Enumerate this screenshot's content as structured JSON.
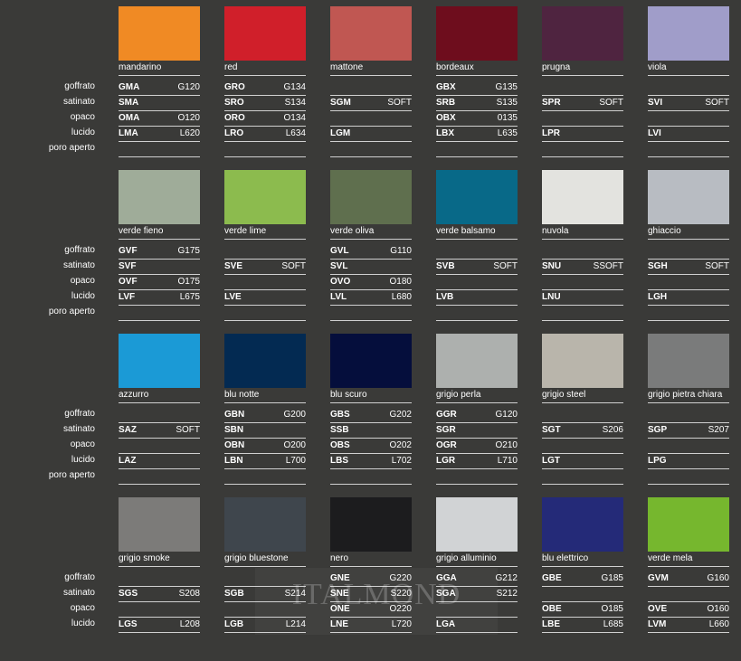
{
  "row_labels": [
    "goffrato",
    "satinato",
    "opaco",
    "lucido",
    "poro aperto"
  ],
  "blocks": [
    {
      "colors": [
        {
          "name": "mandarino",
          "swatch": "#f08a24",
          "rows": [
            [
              "GMA",
              "G120"
            ],
            [
              "SMA",
              ""
            ],
            [
              "OMA",
              "O120"
            ],
            [
              "LMA",
              "L620"
            ],
            [
              "",
              ""
            ]
          ]
        },
        {
          "name": "red",
          "swatch": "#d01f2a",
          "rows": [
            [
              "GRO",
              "G134"
            ],
            [
              "SRO",
              "S134"
            ],
            [
              "ORO",
              "O134"
            ],
            [
              "LRO",
              "L634"
            ],
            [
              "",
              ""
            ]
          ]
        },
        {
          "name": "mattone",
          "swatch": "#c05752",
          "rows": [
            [
              "",
              ""
            ],
            [
              "SGM",
              "SOFT"
            ],
            [
              "",
              ""
            ],
            [
              "LGM",
              ""
            ],
            [
              "",
              ""
            ]
          ]
        },
        {
          "name": "bordeaux",
          "swatch": "#6e0d1d",
          "rows": [
            [
              "GBX",
              "G135"
            ],
            [
              "SRB",
              "S135"
            ],
            [
              "OBX",
              "0135"
            ],
            [
              "LBX",
              "L635"
            ],
            [
              "",
              ""
            ]
          ]
        },
        {
          "name": "prugna",
          "swatch": "#4f2440",
          "rows": [
            [
              "",
              ""
            ],
            [
              "SPR",
              "SOFT"
            ],
            [
              "",
              ""
            ],
            [
              "LPR",
              ""
            ],
            [
              "",
              ""
            ]
          ]
        },
        {
          "name": "viola",
          "swatch": "#a09dc9",
          "rows": [
            [
              "",
              ""
            ],
            [
              "SVI",
              "SOFT"
            ],
            [
              "",
              ""
            ],
            [
              "LVI",
              ""
            ],
            [
              "",
              ""
            ]
          ]
        }
      ]
    },
    {
      "colors": [
        {
          "name": "verde fieno",
          "swatch": "#9fac99",
          "rows": [
            [
              "GVF",
              "G175"
            ],
            [
              "SVF",
              ""
            ],
            [
              "OVF",
              "O175"
            ],
            [
              "LVF",
              "L675"
            ],
            [
              "",
              ""
            ]
          ]
        },
        {
          "name": "verde lime",
          "swatch": "#8cbb4e",
          "rows": [
            [
              "",
              ""
            ],
            [
              "SVE",
              "SOFT"
            ],
            [
              "",
              ""
            ],
            [
              "LVE",
              ""
            ],
            [
              "",
              ""
            ]
          ]
        },
        {
          "name": "verde oliva",
          "swatch": "#5f6f4e",
          "rows": [
            [
              "GVL",
              "G110"
            ],
            [
              "SVL",
              ""
            ],
            [
              "OVO",
              "O180"
            ],
            [
              "LVL",
              "L680"
            ],
            [
              "",
              ""
            ]
          ]
        },
        {
          "name": "verde balsamo",
          "swatch": "#086988",
          "rows": [
            [
              "",
              ""
            ],
            [
              "SVB",
              "SOFT"
            ],
            [
              "",
              ""
            ],
            [
              "LVB",
              ""
            ],
            [
              "",
              ""
            ]
          ]
        },
        {
          "name": "nuvola",
          "swatch": "#e3e3df",
          "rows": [
            [
              "",
              ""
            ],
            [
              "SNU",
              "SSOFT"
            ],
            [
              "",
              ""
            ],
            [
              "LNU",
              ""
            ],
            [
              "",
              ""
            ]
          ]
        },
        {
          "name": "ghiaccio",
          "swatch": "#b8bcc2",
          "rows": [
            [
              "",
              ""
            ],
            [
              "SGH",
              "SOFT"
            ],
            [
              "",
              ""
            ],
            [
              "LGH",
              ""
            ],
            [
              "",
              ""
            ]
          ]
        }
      ]
    },
    {
      "colors": [
        {
          "name": "azzurro",
          "swatch": "#1b9ad6",
          "rows": [
            [
              "",
              ""
            ],
            [
              "SAZ",
              "SOFT"
            ],
            [
              "",
              ""
            ],
            [
              "LAZ",
              ""
            ],
            [
              "",
              ""
            ]
          ]
        },
        {
          "name": "blu notte",
          "swatch": "#032a52",
          "rows": [
            [
              "GBN",
              "G200"
            ],
            [
              "SBN",
              ""
            ],
            [
              "OBN",
              "O200"
            ],
            [
              "LBN",
              "L700"
            ],
            [
              "",
              ""
            ]
          ]
        },
        {
          "name": "blu scuro",
          "swatch": "#050e3c",
          "rows": [
            [
              "GBS",
              "G202"
            ],
            [
              "SSB",
              ""
            ],
            [
              "OBS",
              "O202"
            ],
            [
              "LBS",
              "L702"
            ],
            [
              "",
              ""
            ]
          ]
        },
        {
          "name": "grigio perla",
          "swatch": "#adb0ae",
          "rows": [
            [
              "GGR",
              "G120"
            ],
            [
              "SGR",
              ""
            ],
            [
              "OGR",
              "O210"
            ],
            [
              "LGR",
              "L710"
            ],
            [
              "",
              ""
            ]
          ]
        },
        {
          "name": "grigio steel",
          "swatch": "#b9b5ab",
          "rows": [
            [
              "",
              ""
            ],
            [
              "SGT",
              "S206"
            ],
            [
              "",
              ""
            ],
            [
              "LGT",
              ""
            ],
            [
              "",
              ""
            ]
          ]
        },
        {
          "name": "grigio pietra chiara",
          "swatch": "#7a7b7b",
          "rows": [
            [
              "",
              ""
            ],
            [
              "SGP",
              "S207"
            ],
            [
              "",
              ""
            ],
            [
              "LPG",
              ""
            ],
            [
              "",
              ""
            ]
          ]
        }
      ]
    },
    {
      "colors": [
        {
          "name": "grigio smoke",
          "swatch": "#7c7b79",
          "rows": [
            [
              "",
              ""
            ],
            [
              "SGS",
              "S208"
            ],
            [
              "",
              ""
            ],
            [
              "LGS",
              "L208"
            ]
          ]
        },
        {
          "name": "grigio bluestone",
          "swatch": "#3f464d",
          "rows": [
            [
              "",
              ""
            ],
            [
              "SGB",
              "S214"
            ],
            [
              "",
              ""
            ],
            [
              "LGB",
              "L214"
            ]
          ]
        },
        {
          "name": "nero",
          "swatch": "#1c1c1e",
          "rows": [
            [
              "GNE",
              "G220"
            ],
            [
              "SNE",
              "S220"
            ],
            [
              "ONE",
              "O220"
            ],
            [
              "LNE",
              "L720"
            ]
          ]
        },
        {
          "name": "grigio alluminio",
          "swatch": "#d1d3d5",
          "rows": [
            [
              "GGA",
              "G212"
            ],
            [
              "SGA",
              "S212"
            ],
            [
              "",
              ""
            ],
            [
              "LGA",
              ""
            ]
          ]
        },
        {
          "name": "blu elettrico",
          "swatch": "#242a78",
          "rows": [
            [
              "GBE",
              "G185"
            ],
            [
              "",
              ""
            ],
            [
              "OBE",
              "O185"
            ],
            [
              "LBE",
              "L685"
            ]
          ]
        },
        {
          "name": "verde mela",
          "swatch": "#76b72e",
          "rows": [
            [
              "GVM",
              "G160"
            ],
            [
              "",
              ""
            ],
            [
              "OVE",
              "O160"
            ],
            [
              "LVM",
              "L660"
            ]
          ]
        }
      ]
    }
  ],
  "watermark": "ITALMOND"
}
